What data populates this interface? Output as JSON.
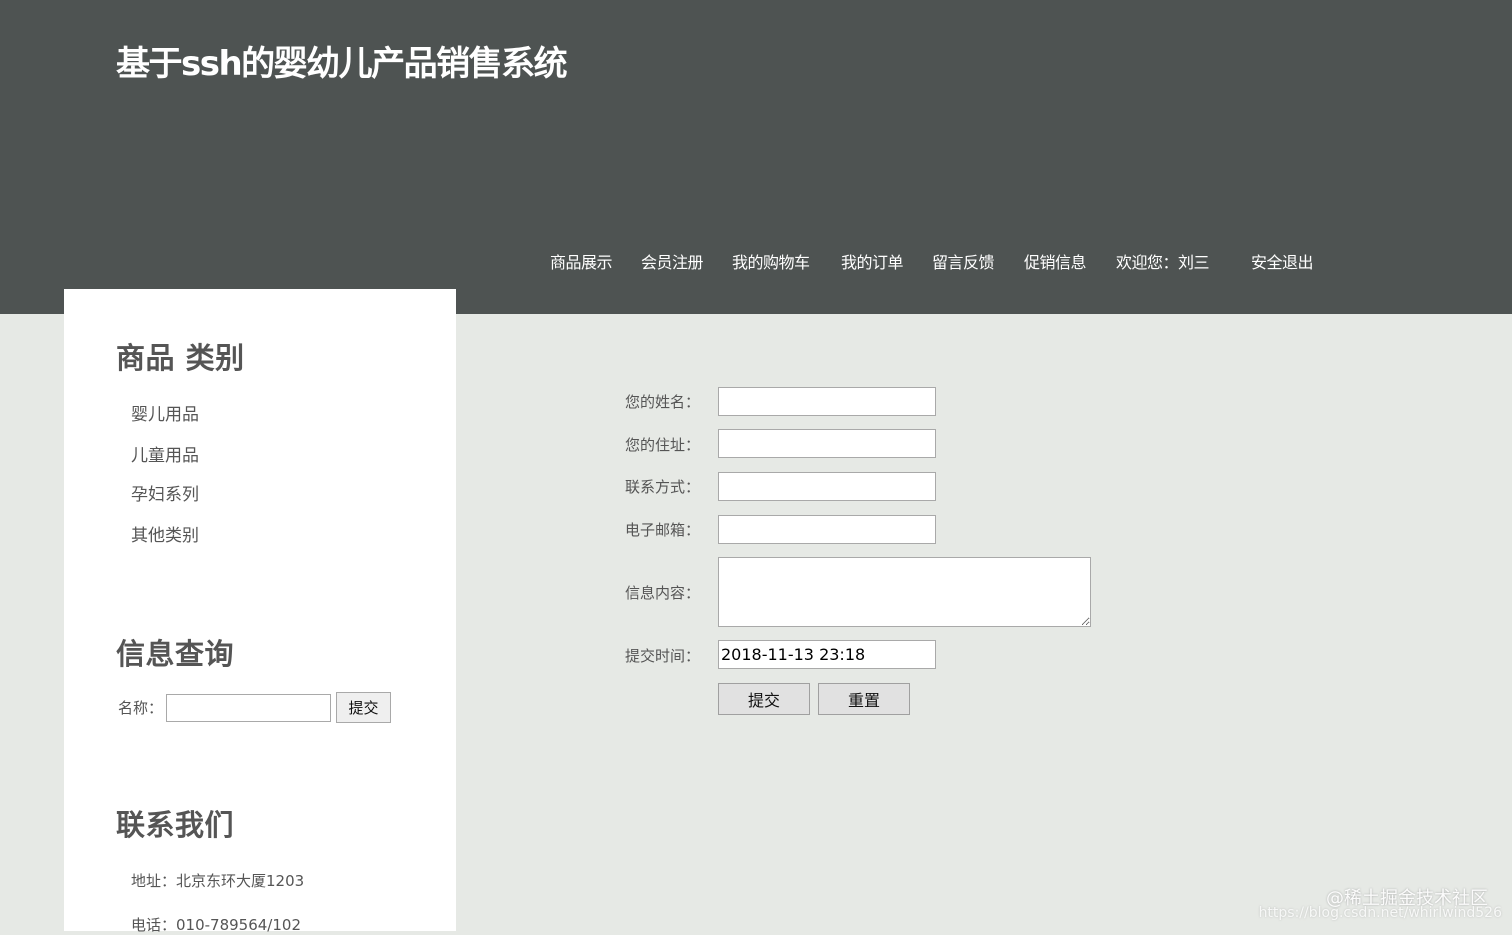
{
  "header": {
    "title": "基于ssh的婴幼儿产品销售系统",
    "nav": [
      "商品展示",
      "会员注册",
      "我的购物车",
      "我的订单",
      "留言反馈",
      "促销信息",
      "欢迎您：刘三",
      "安全退出"
    ]
  },
  "sidebar": {
    "categories_heading": "商品 类别",
    "categories": [
      "婴儿用品",
      "儿童用品",
      "孕妇系列",
      "其他类别"
    ],
    "query_heading": "信息查询",
    "query_label": "名称：",
    "query_value": "",
    "query_button": "提交",
    "contact_heading": "联系我们",
    "contact_address": "地址：北京东环大厦1203",
    "contact_phone": "电话：010-789564/102"
  },
  "form": {
    "name_label": "您的姓名：",
    "name_value": "",
    "address_label": "您的住址：",
    "address_value": "",
    "contact_label": "联系方式：",
    "contact_value": "",
    "email_label": "电子邮箱：",
    "email_value": "",
    "content_label": "信息内容：",
    "content_value": "",
    "time_label": "提交时间：",
    "time_value": "2018-11-13 23:18",
    "submit_label": "提交",
    "reset_label": "重置"
  },
  "watermark": {
    "text": "@稀土掘金技术社区",
    "url": "https://blog.csdn.net/whirlwind526"
  },
  "colors": {
    "header_bg": "#4e5352",
    "page_bg": "#e6e9e5",
    "sidebar_bg": "#ffffff",
    "text_gray": "#555555"
  }
}
